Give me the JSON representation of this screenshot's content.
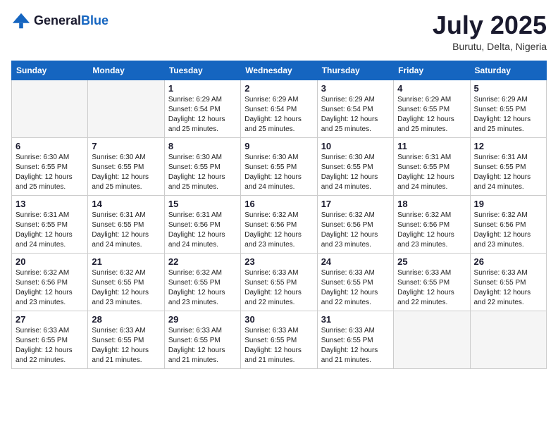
{
  "header": {
    "logo_general": "General",
    "logo_blue": "Blue",
    "month_title": "July 2025",
    "location": "Burutu, Delta, Nigeria"
  },
  "days_of_week": [
    "Sunday",
    "Monday",
    "Tuesday",
    "Wednesday",
    "Thursday",
    "Friday",
    "Saturday"
  ],
  "weeks": [
    [
      {
        "num": "",
        "info": ""
      },
      {
        "num": "",
        "info": ""
      },
      {
        "num": "1",
        "info": "Sunrise: 6:29 AM\nSunset: 6:54 PM\nDaylight: 12 hours and 25 minutes."
      },
      {
        "num": "2",
        "info": "Sunrise: 6:29 AM\nSunset: 6:54 PM\nDaylight: 12 hours and 25 minutes."
      },
      {
        "num": "3",
        "info": "Sunrise: 6:29 AM\nSunset: 6:54 PM\nDaylight: 12 hours and 25 minutes."
      },
      {
        "num": "4",
        "info": "Sunrise: 6:29 AM\nSunset: 6:55 PM\nDaylight: 12 hours and 25 minutes."
      },
      {
        "num": "5",
        "info": "Sunrise: 6:29 AM\nSunset: 6:55 PM\nDaylight: 12 hours and 25 minutes."
      }
    ],
    [
      {
        "num": "6",
        "info": "Sunrise: 6:30 AM\nSunset: 6:55 PM\nDaylight: 12 hours and 25 minutes."
      },
      {
        "num": "7",
        "info": "Sunrise: 6:30 AM\nSunset: 6:55 PM\nDaylight: 12 hours and 25 minutes."
      },
      {
        "num": "8",
        "info": "Sunrise: 6:30 AM\nSunset: 6:55 PM\nDaylight: 12 hours and 25 minutes."
      },
      {
        "num": "9",
        "info": "Sunrise: 6:30 AM\nSunset: 6:55 PM\nDaylight: 12 hours and 24 minutes."
      },
      {
        "num": "10",
        "info": "Sunrise: 6:30 AM\nSunset: 6:55 PM\nDaylight: 12 hours and 24 minutes."
      },
      {
        "num": "11",
        "info": "Sunrise: 6:31 AM\nSunset: 6:55 PM\nDaylight: 12 hours and 24 minutes."
      },
      {
        "num": "12",
        "info": "Sunrise: 6:31 AM\nSunset: 6:55 PM\nDaylight: 12 hours and 24 minutes."
      }
    ],
    [
      {
        "num": "13",
        "info": "Sunrise: 6:31 AM\nSunset: 6:55 PM\nDaylight: 12 hours and 24 minutes."
      },
      {
        "num": "14",
        "info": "Sunrise: 6:31 AM\nSunset: 6:55 PM\nDaylight: 12 hours and 24 minutes."
      },
      {
        "num": "15",
        "info": "Sunrise: 6:31 AM\nSunset: 6:56 PM\nDaylight: 12 hours and 24 minutes."
      },
      {
        "num": "16",
        "info": "Sunrise: 6:32 AM\nSunset: 6:56 PM\nDaylight: 12 hours and 23 minutes."
      },
      {
        "num": "17",
        "info": "Sunrise: 6:32 AM\nSunset: 6:56 PM\nDaylight: 12 hours and 23 minutes."
      },
      {
        "num": "18",
        "info": "Sunrise: 6:32 AM\nSunset: 6:56 PM\nDaylight: 12 hours and 23 minutes."
      },
      {
        "num": "19",
        "info": "Sunrise: 6:32 AM\nSunset: 6:56 PM\nDaylight: 12 hours and 23 minutes."
      }
    ],
    [
      {
        "num": "20",
        "info": "Sunrise: 6:32 AM\nSunset: 6:56 PM\nDaylight: 12 hours and 23 minutes."
      },
      {
        "num": "21",
        "info": "Sunrise: 6:32 AM\nSunset: 6:55 PM\nDaylight: 12 hours and 23 minutes."
      },
      {
        "num": "22",
        "info": "Sunrise: 6:32 AM\nSunset: 6:55 PM\nDaylight: 12 hours and 23 minutes."
      },
      {
        "num": "23",
        "info": "Sunrise: 6:33 AM\nSunset: 6:55 PM\nDaylight: 12 hours and 22 minutes."
      },
      {
        "num": "24",
        "info": "Sunrise: 6:33 AM\nSunset: 6:55 PM\nDaylight: 12 hours and 22 minutes."
      },
      {
        "num": "25",
        "info": "Sunrise: 6:33 AM\nSunset: 6:55 PM\nDaylight: 12 hours and 22 minutes."
      },
      {
        "num": "26",
        "info": "Sunrise: 6:33 AM\nSunset: 6:55 PM\nDaylight: 12 hours and 22 minutes."
      }
    ],
    [
      {
        "num": "27",
        "info": "Sunrise: 6:33 AM\nSunset: 6:55 PM\nDaylight: 12 hours and 22 minutes."
      },
      {
        "num": "28",
        "info": "Sunrise: 6:33 AM\nSunset: 6:55 PM\nDaylight: 12 hours and 21 minutes."
      },
      {
        "num": "29",
        "info": "Sunrise: 6:33 AM\nSunset: 6:55 PM\nDaylight: 12 hours and 21 minutes."
      },
      {
        "num": "30",
        "info": "Sunrise: 6:33 AM\nSunset: 6:55 PM\nDaylight: 12 hours and 21 minutes."
      },
      {
        "num": "31",
        "info": "Sunrise: 6:33 AM\nSunset: 6:55 PM\nDaylight: 12 hours and 21 minutes."
      },
      {
        "num": "",
        "info": ""
      },
      {
        "num": "",
        "info": ""
      }
    ]
  ]
}
